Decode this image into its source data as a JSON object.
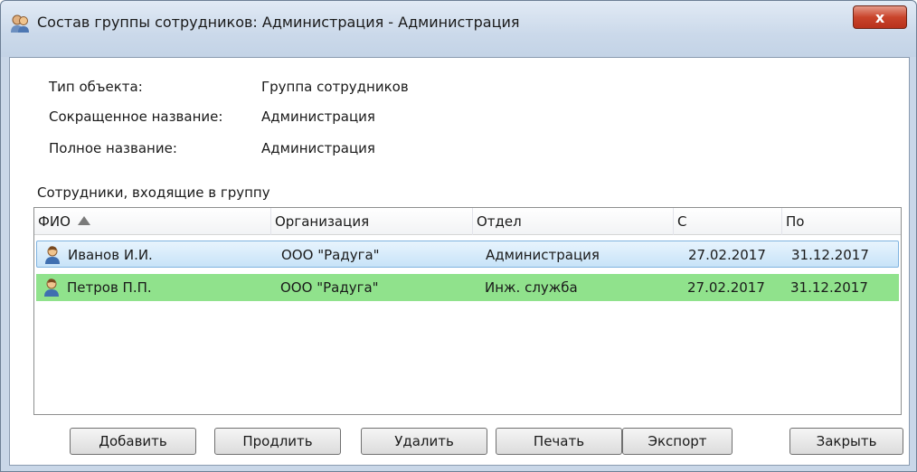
{
  "window": {
    "title": "Состав группы сотрудников: Администрация - Администрация",
    "close_label": "x"
  },
  "info": {
    "type_label": "Тип объекта:",
    "type_value": "Группа сотрудников",
    "short_label": "Сокращенное название:",
    "short_value": "Администрация",
    "full_label": "Полное название:",
    "full_value": "Администрация"
  },
  "members": {
    "section_label": "Сотрудники, входящие в группу",
    "columns": [
      "ФИО",
      "Организация",
      "Отдел",
      "С",
      "По"
    ],
    "sort_column": "ФИО",
    "rows": [
      {
        "name": "Иванов И.И.",
        "org": "ООО \"Радуга\"",
        "dept": "Администрация",
        "from": "27.02.2017",
        "to": "31.12.2017",
        "state": "selected"
      },
      {
        "name": "Петров П.П.",
        "org": "ООО \"Радуга\"",
        "dept": "Инж. служба",
        "from": "27.02.2017",
        "to": "31.12.2017",
        "state": "highlighted"
      }
    ]
  },
  "buttons": {
    "add": "Добавить",
    "extend": "Продлить",
    "delete": "Удалить",
    "print": "Печать",
    "export": "Экспорт",
    "close": "Закрыть"
  },
  "colors": {
    "selected_row": "#c7e3f8",
    "highlighted_row": "#90e28c",
    "close_button": "#c9442b"
  },
  "icons": {
    "title": "group-people-icon",
    "row": "person-icon",
    "sort": "sort-ascending-icon"
  }
}
